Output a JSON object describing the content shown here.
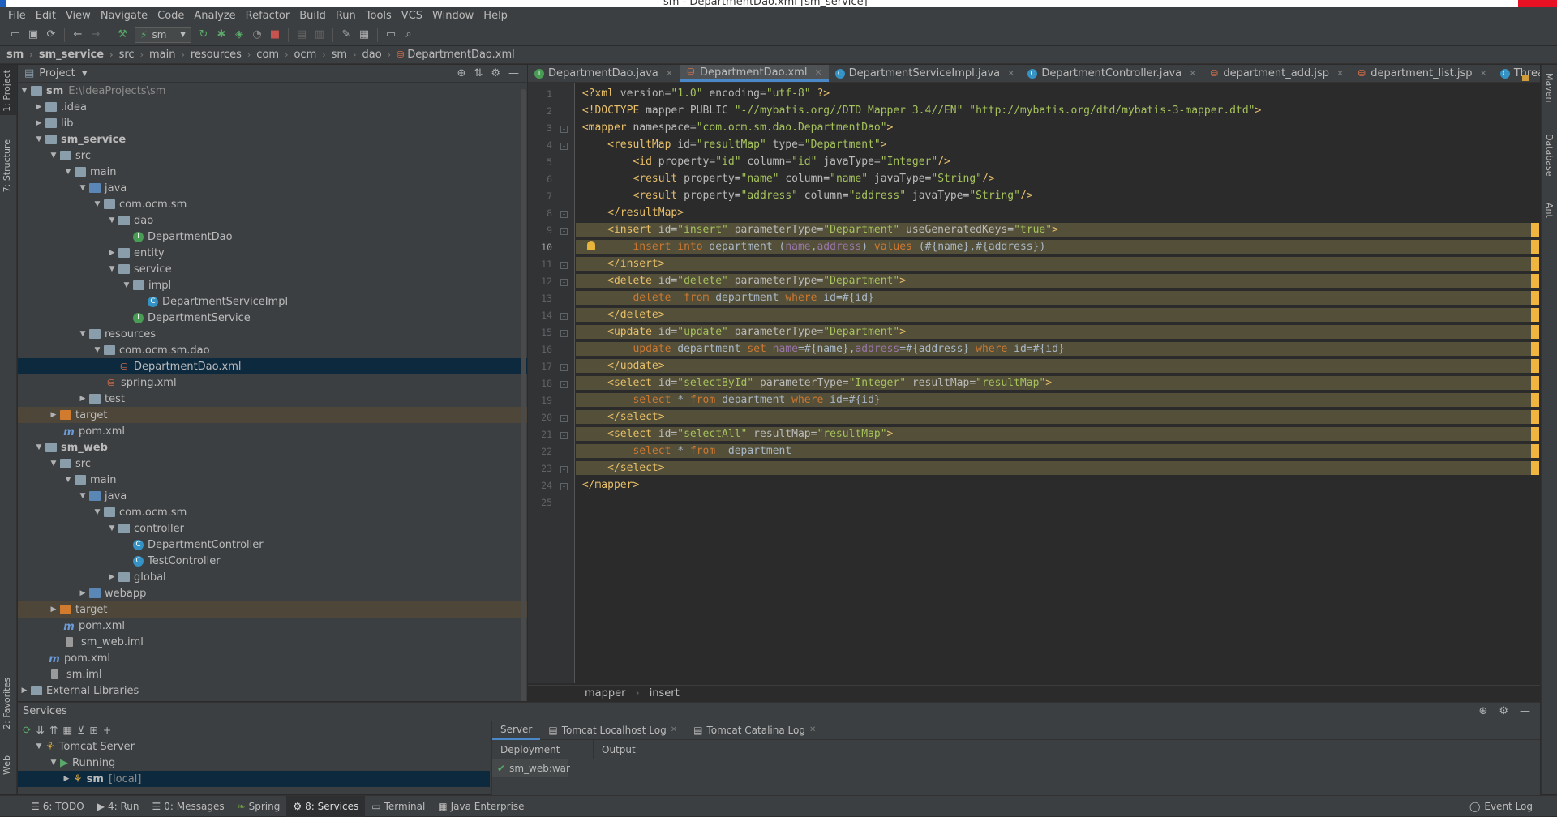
{
  "window": {
    "title": "sm - DepartmentDao.xml [sm_service]"
  },
  "menu": [
    "File",
    "Edit",
    "View",
    "Navigate",
    "Code",
    "Analyze",
    "Refactor",
    "Build",
    "Run",
    "Tools",
    "VCS",
    "Window",
    "Help"
  ],
  "toolbar": {
    "run_config": "sm"
  },
  "breadcrumb": [
    "sm",
    "sm_service",
    "src",
    "main",
    "resources",
    "com",
    "ocm",
    "sm",
    "dao",
    "DepartmentDao.xml"
  ],
  "left_strip": {
    "project": "1: Project",
    "structure": "7: Structure",
    "favorites": "2: Favorites",
    "web": "Web"
  },
  "right_strip": {
    "maven": "Maven",
    "database": "Database",
    "ant": "Ant"
  },
  "project_panel": {
    "title": "Project",
    "tree": [
      {
        "label": "sm",
        "extra": "E:\\IdeaProjects\\sm",
        "bold": true
      },
      {
        "label": ".idea"
      },
      {
        "label": "lib"
      },
      {
        "label": "sm_service",
        "bold": true
      },
      {
        "label": "src"
      },
      {
        "label": "main"
      },
      {
        "label": "java"
      },
      {
        "label": "com.ocm.sm"
      },
      {
        "label": "dao"
      },
      {
        "label": "DepartmentDao"
      },
      {
        "label": "entity"
      },
      {
        "label": "service"
      },
      {
        "label": "impl"
      },
      {
        "label": "DepartmentServiceImpl"
      },
      {
        "label": "DepartmentService"
      },
      {
        "label": "resources"
      },
      {
        "label": "com.ocm.sm.dao"
      },
      {
        "label": "DepartmentDao.xml"
      },
      {
        "label": "spring.xml"
      },
      {
        "label": "test"
      },
      {
        "label": "target"
      },
      {
        "label": "pom.xml"
      },
      {
        "label": "sm_web",
        "bold": true
      },
      {
        "label": "src"
      },
      {
        "label": "main"
      },
      {
        "label": "java"
      },
      {
        "label": "com.ocm.sm"
      },
      {
        "label": "controller"
      },
      {
        "label": "DepartmentController"
      },
      {
        "label": "TestController"
      },
      {
        "label": "global"
      },
      {
        "label": "webapp"
      },
      {
        "label": "target"
      },
      {
        "label": "pom.xml"
      },
      {
        "label": "sm_web.iml"
      },
      {
        "label": "pom.xml"
      },
      {
        "label": "sm.iml"
      },
      {
        "label": "External Libraries"
      }
    ]
  },
  "editor": {
    "tabs": [
      {
        "label": "DepartmentDao.java",
        "icon": "interface"
      },
      {
        "label": "DepartmentDao.xml",
        "icon": "xml",
        "active": true
      },
      {
        "label": "DepartmentServiceImpl.java",
        "icon": "class"
      },
      {
        "label": "DepartmentController.java",
        "icon": "class"
      },
      {
        "label": "department_add.jsp",
        "icon": "jsp"
      },
      {
        "label": "department_list.jsp",
        "icon": "jsp"
      },
      {
        "label": "Thread.java",
        "icon": "class"
      }
    ],
    "current_line": 10,
    "lines": [
      "<?xml version=\"1.0\" encoding=\"utf-8\" ?>",
      "<!DOCTYPE mapper PUBLIC \"-//mybatis.org//DTD Mapper 3.4//EN\" \"http://mybatis.org/dtd/mybatis-3-mapper.dtd\">",
      "<mapper namespace=\"com.ocm.sm.dao.DepartmentDao\">",
      "    <resultMap id=\"resultMap\" type=\"Department\">",
      "        <id property=\"id\" column=\"id\" javaType=\"Integer\"/>",
      "        <result property=\"name\" column=\"name\" javaType=\"String\"/>",
      "        <result property=\"address\" column=\"address\" javaType=\"String\"/>",
      "    </resultMap>",
      "    <insert id=\"insert\" parameterType=\"Department\" useGeneratedKeys=\"true\">",
      "        insert into department (name,address) values (#{name},#{address})",
      "    </insert>",
      "    <delete id=\"delete\" parameterType=\"Department\">",
      "        delete  from department where id=#{id}",
      "    </delete>",
      "    <update id=\"update\" parameterType=\"Department\">",
      "        update department set name=#{name},address=#{address} where id=#{id}",
      "    </update>",
      "    <select id=\"selectById\" parameterType=\"Integer\" resultMap=\"resultMap\">",
      "        select * from department where id=#{id}",
      "    </select>",
      "    <select id=\"selectAll\" resultMap=\"resultMap\">",
      "        select * from  department",
      "    </select>",
      "</mapper>",
      ""
    ],
    "crumb": [
      "mapper",
      "insert"
    ]
  },
  "services": {
    "title": "Services",
    "tree": [
      {
        "label": "Tomcat Server"
      },
      {
        "label": "Running"
      },
      {
        "label": "sm",
        "extra": "[local]"
      }
    ],
    "tabs": [
      "Server",
      "Tomcat Localhost Log",
      "Tomcat Catalina Log"
    ],
    "subtabs": [
      "Deployment",
      "Output"
    ],
    "deployment": "sm_web:war"
  },
  "statusbar": {
    "items": [
      "6: TODO",
      "4: Run",
      "0: Messages",
      "Spring",
      "8: Services",
      "Terminal",
      "Java Enterprise"
    ],
    "event_log": "Event Log"
  },
  "colors": {
    "accent": "#4a88c7",
    "selection": "#0d293e",
    "highlight": "#534f38"
  }
}
